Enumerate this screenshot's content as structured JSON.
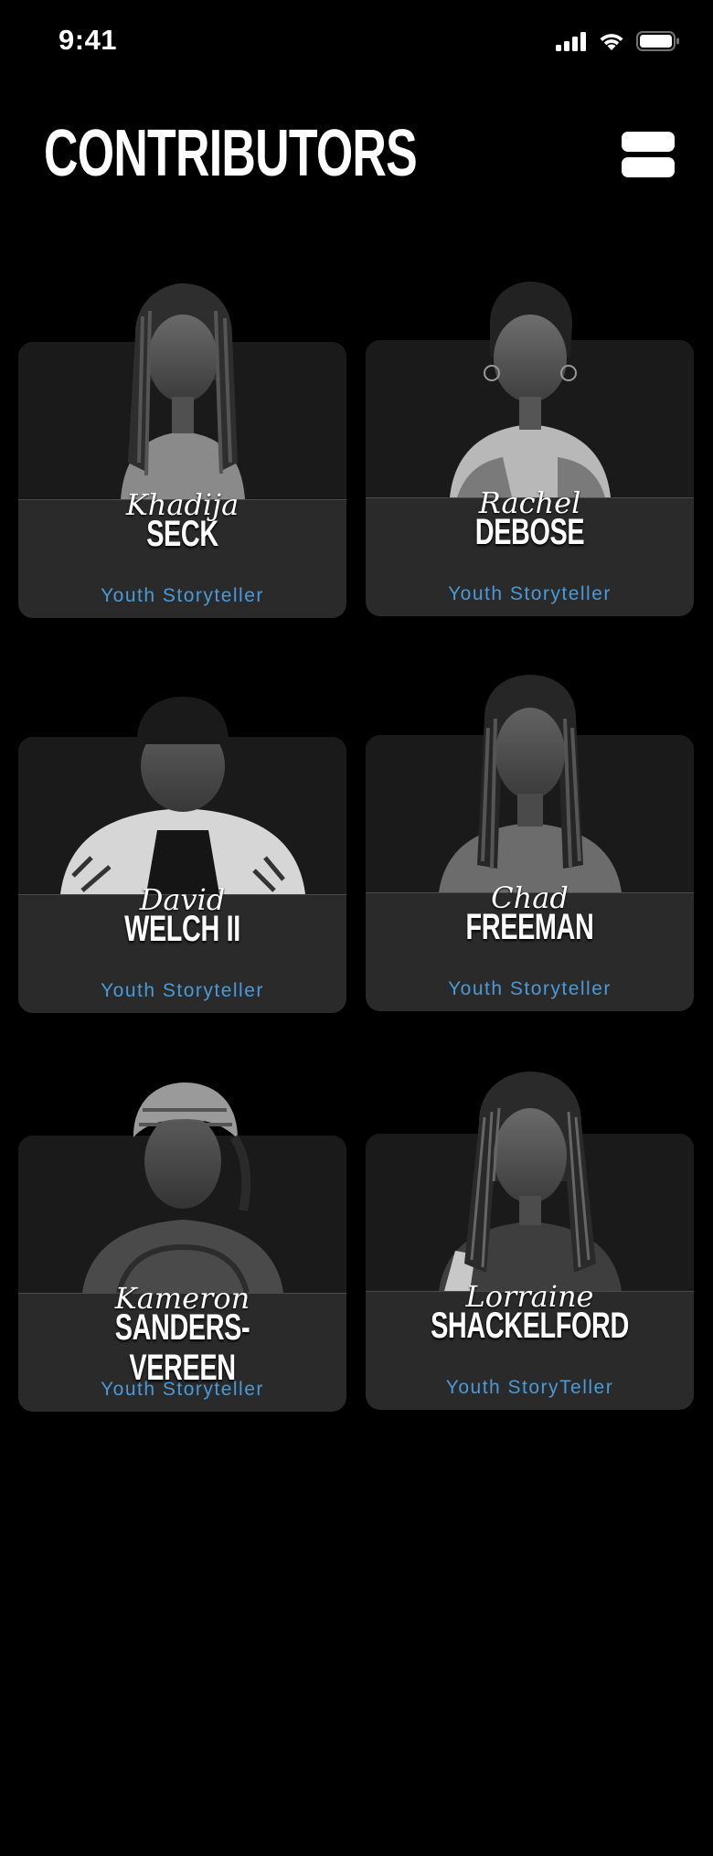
{
  "status_bar": {
    "time": "9:41",
    "icons": [
      "cellular-signal-icon",
      "wifi-icon",
      "battery-icon"
    ]
  },
  "header": {
    "title": "CONTRIBUTORS",
    "menu_icon": "stacked-bars-menu-icon"
  },
  "colors": {
    "background": "#000000",
    "card": "#2a2a2a",
    "card_photo_area": "#1a1a1a",
    "role_text": "#4a9ad8"
  },
  "contributors": [
    {
      "first_name": "Khadija",
      "last_name": "SECK",
      "role": "Youth Storyteller"
    },
    {
      "first_name": "Rachel",
      "last_name": "DEBOSE",
      "role": "Youth Storyteller"
    },
    {
      "first_name": "David",
      "last_name": "WELCH II",
      "role": "Youth Storyteller"
    },
    {
      "first_name": "Chad",
      "last_name": "FREEMAN",
      "role": "Youth Storyteller"
    },
    {
      "first_name": "Kameron",
      "last_name": "SANDERS-VEREEN",
      "role": "Youth Storyteller"
    },
    {
      "first_name": "Lorraine",
      "last_name": "SHACKELFORD",
      "role": "Youth StoryTeller"
    }
  ]
}
